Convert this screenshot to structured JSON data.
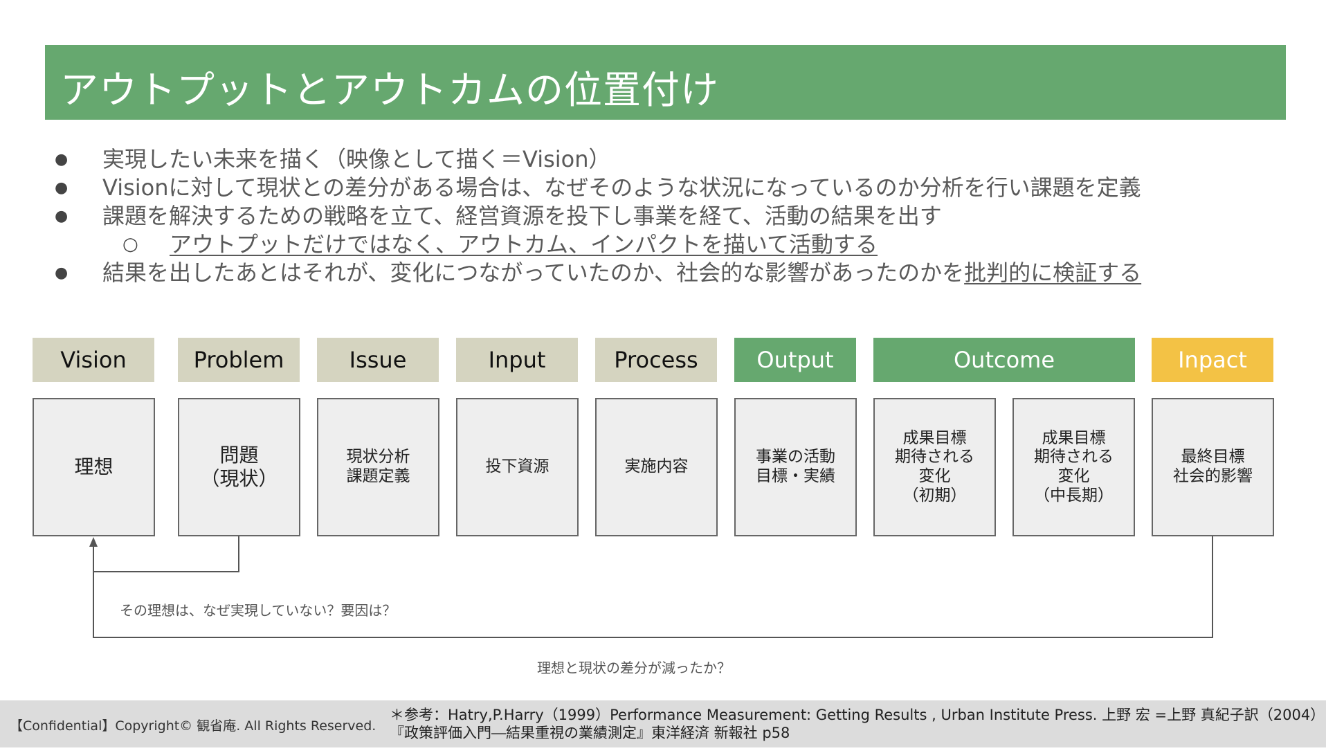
{
  "title": "アウトプットとアウトカムの位置付け",
  "bullets": [
    {
      "text": "実現したい未来を描く（映像として描く＝Vision）"
    },
    {
      "text": "Visionに対して現状との差分がある場合は、なぜそのような状況になっているのか分析を行い課題を定義"
    },
    {
      "text": "課題を解決するための戦略を立て、経営資源を投下し事業を経て、活動の結果を出す"
    },
    {
      "text": "アウトプットだけではなく、アウトカム、インパクトを描いて活動する"
    },
    {
      "text": "結果を出したあとはそれが、変化につながっていたのか、社会的な影響があったのかを",
      "underlined": "批判的に検証する"
    }
  ],
  "headers": {
    "vision": "Vision",
    "problem": "Problem",
    "issue": "Issue",
    "input": "Input",
    "process": "Process",
    "output": "Output",
    "outcome": "Outcome",
    "impact": "Inpact"
  },
  "stages": {
    "vision": "理想",
    "problem": "問題\n（現状）",
    "issue": "現状分析\n課題定義",
    "input": "投下資源",
    "process": "実施内容",
    "output": "事業の活動\n目標・実績",
    "outcome_initial": "成果目標\n期待される\n変化\n（初期）",
    "outcome_long": "成果目標\n期待される\n変化\n（中長期）",
    "impact": "最終目標\n社会的影響"
  },
  "notes": {
    "gap_question": "その理想は、なぜ実現していない？要因は？",
    "gap_reduced": "理想と現状の差分が減ったか？"
  },
  "footer": {
    "copyright": "【Confidential】Copyright© 観省庵. All Rights Reserved.",
    "reference_line1": "＊参考：Hatry,P.Harry（1999）Performance Measurement: Getting Results , Urban Institute Press. 上野 宏 =上野 真紀子訳（2004）",
    "reference_line2": "『政策評価入門―結果重視の業績測定』東洋経済 新報社 p58"
  },
  "colors": {
    "title_bg": "#66a86f",
    "header_gray": "#d5d4c0",
    "header_green": "#66a86f",
    "header_yellow": "#f3c245",
    "box_bg": "#eeeeee",
    "footer_bg": "#dcdcdc"
  }
}
